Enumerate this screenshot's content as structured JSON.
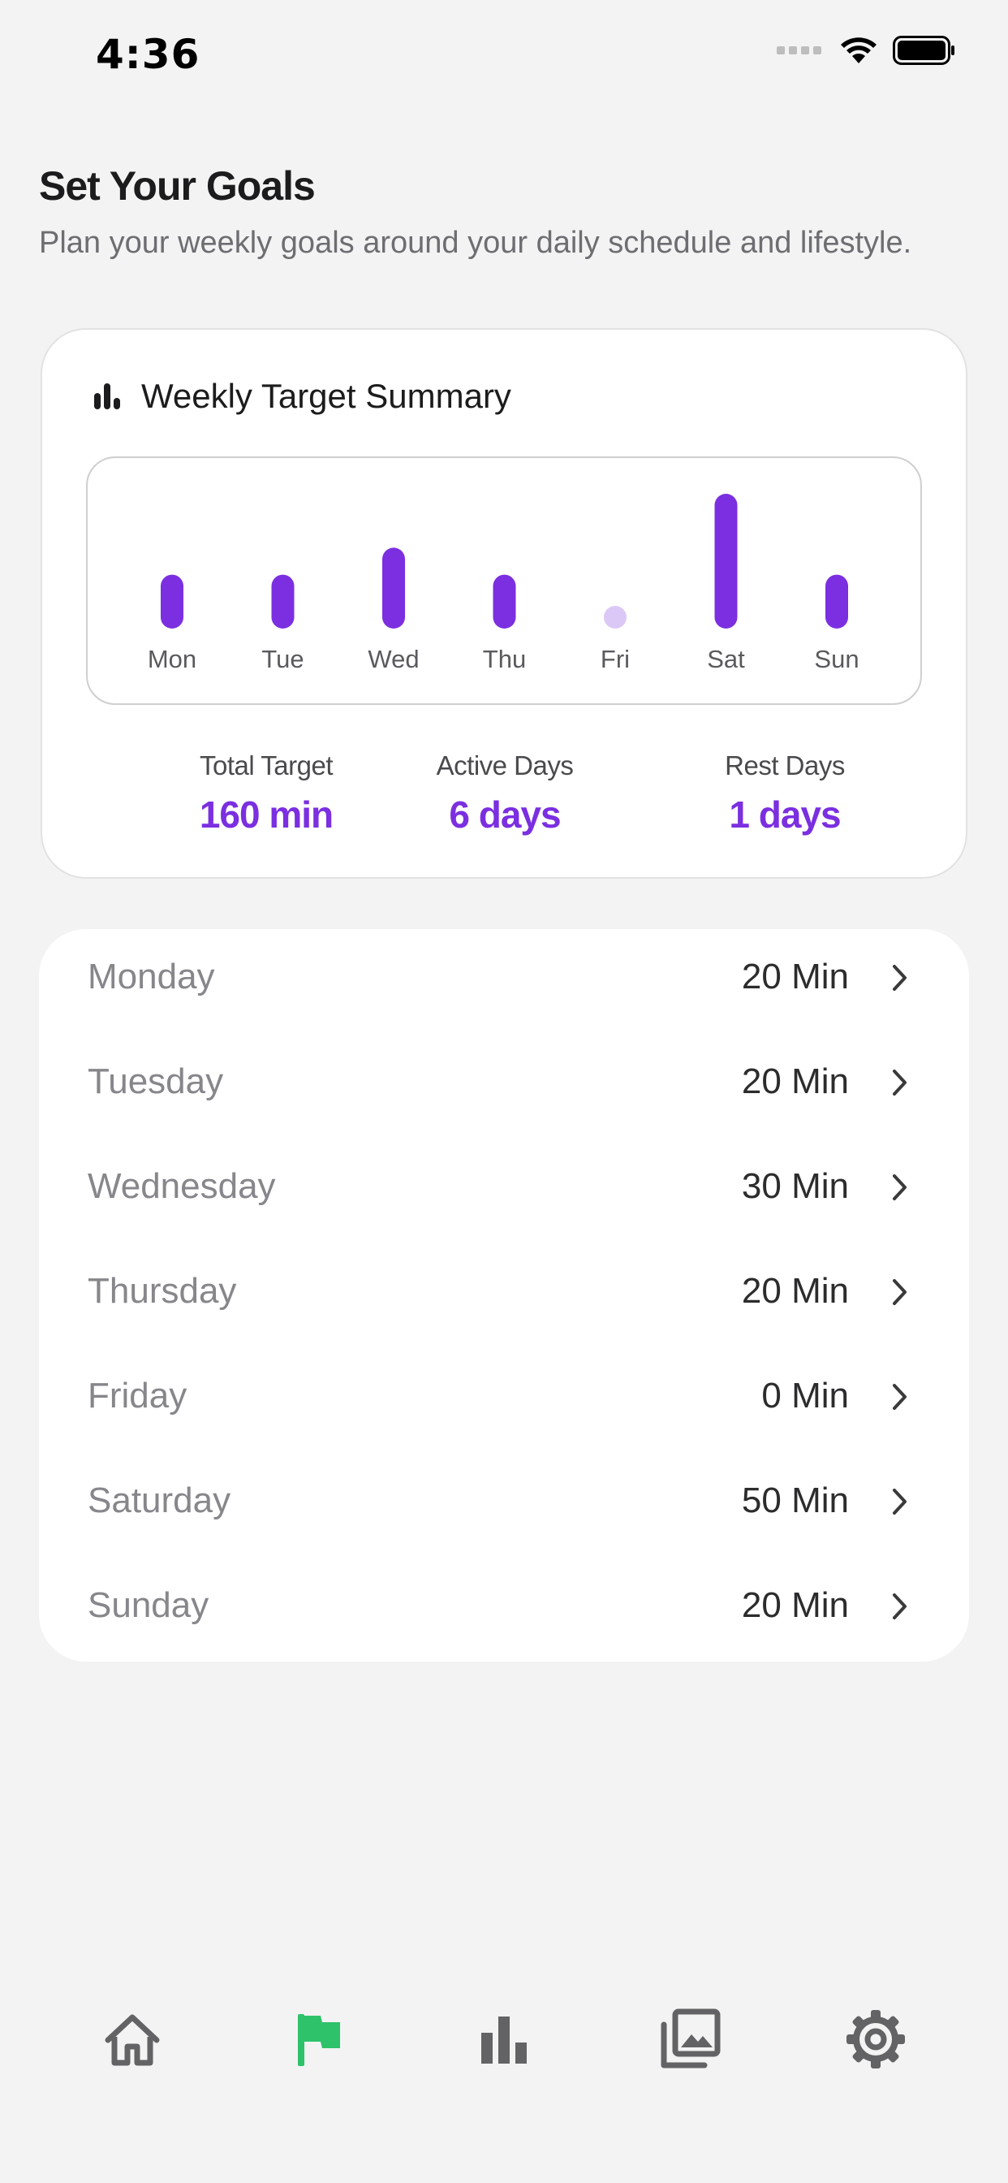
{
  "status_bar": {
    "time": "4:36"
  },
  "header": {
    "title": "Set Your Goals",
    "subtitle": "Plan your weekly goals around your daily schedule and lifestyle."
  },
  "summary": {
    "title": "Weekly Target Summary",
    "icon": "bar-chart-icon",
    "stats": [
      {
        "label": "Total Target",
        "value": "160 min"
      },
      {
        "label": "Active Days",
        "value": "6 days"
      },
      {
        "label": "Rest Days",
        "value": "1 days"
      }
    ]
  },
  "chart_data": {
    "type": "bar",
    "categories": [
      "Mon",
      "Tue",
      "Wed",
      "Thu",
      "Fri",
      "Sat",
      "Sun"
    ],
    "values": [
      20,
      20,
      30,
      20,
      0,
      50,
      20
    ],
    "ylim": [
      0,
      50
    ],
    "grid": false,
    "bar_color": "#7b2fe0",
    "zero_marker_color": "#dcc8f6"
  },
  "days": [
    {
      "name": "Monday",
      "value": "20 Min"
    },
    {
      "name": "Tuesday",
      "value": "20 Min"
    },
    {
      "name": "Wednesday",
      "value": "30 Min"
    },
    {
      "name": "Thursday",
      "value": "20 Min"
    },
    {
      "name": "Friday",
      "value": "0 Min"
    },
    {
      "name": "Saturday",
      "value": "50 Min"
    },
    {
      "name": "Sunday",
      "value": "20 Min"
    }
  ],
  "tab_bar": {
    "items": [
      {
        "icon": "home-icon",
        "active": false
      },
      {
        "icon": "flag-icon",
        "active": true
      },
      {
        "icon": "stats-icon",
        "active": false
      },
      {
        "icon": "gallery-icon",
        "active": false
      },
      {
        "icon": "settings-gear-icon",
        "active": false
      }
    ],
    "active_color": "#2ec26a",
    "inactive_color": "#636366"
  },
  "colors": {
    "accent": "#7b2fe0",
    "background": "#f3f3f3",
    "card": "#ffffff"
  }
}
